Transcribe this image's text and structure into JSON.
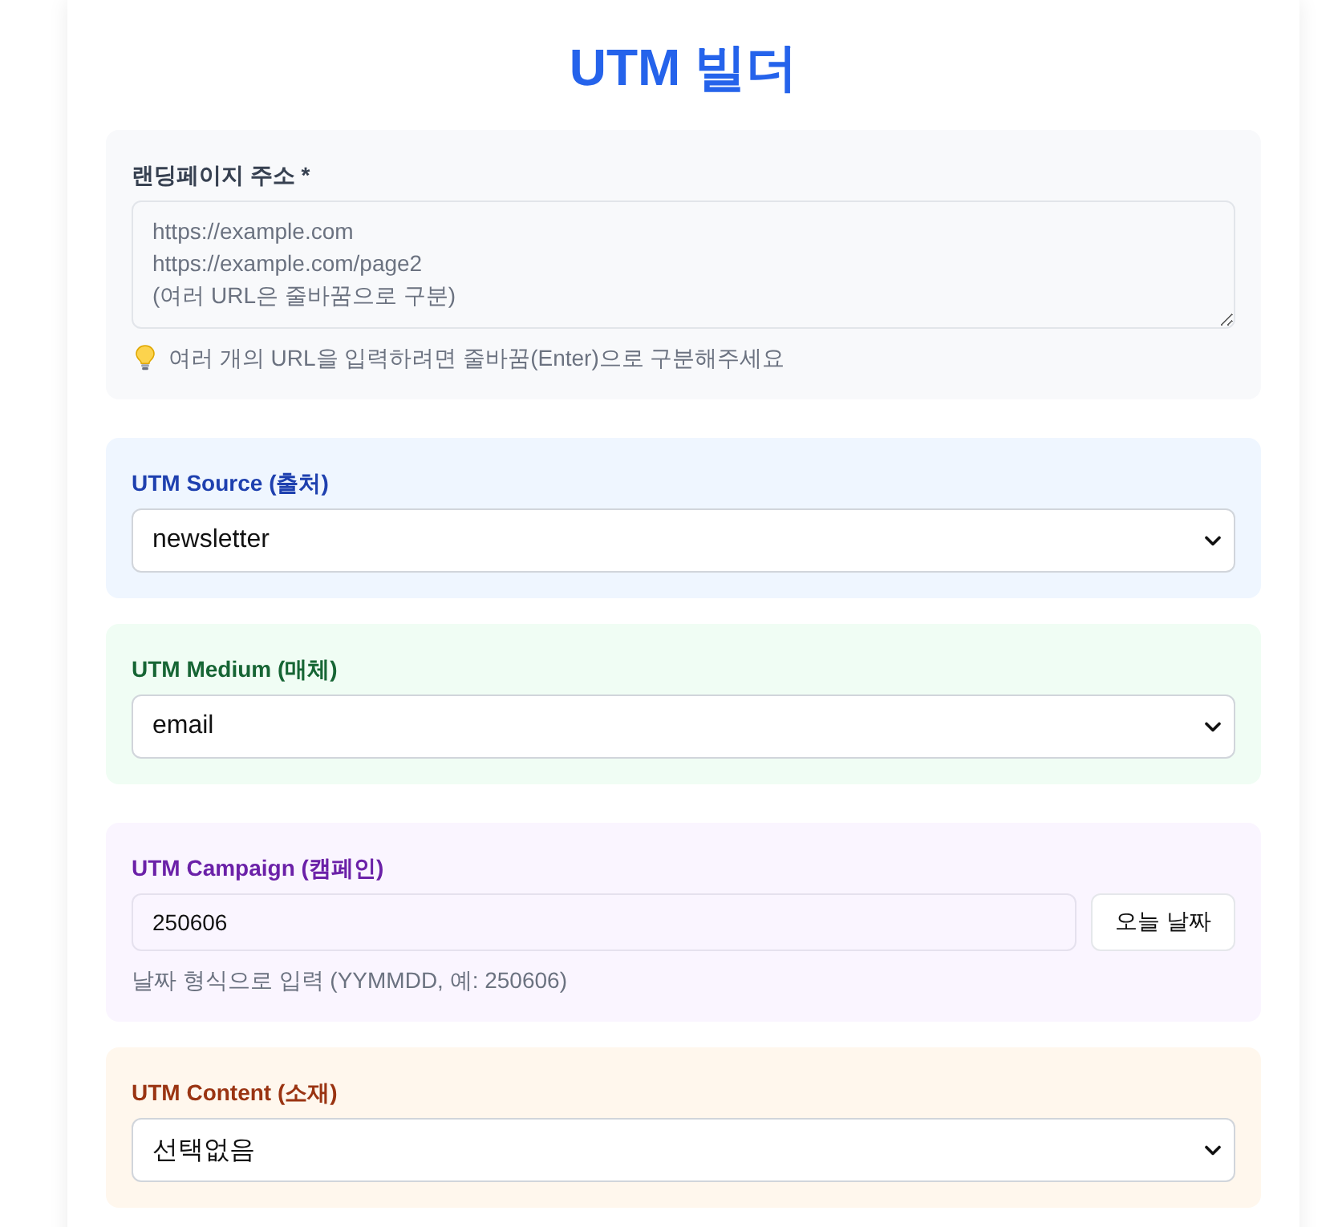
{
  "title": "UTM 빌더",
  "landing": {
    "label": "랜딩페이지 주소 *",
    "placeholder": "https://example.com\nhttps://example.com/page2\n(여러 URL은 줄바꿈으로 구분)",
    "hint": "여러 개의 URL을 입력하려면 줄바꿈(Enter)으로 구분해주세요"
  },
  "fields": [
    {
      "kind": "select",
      "label": "UTM Source (출처)",
      "color": "#1e40af",
      "value": "newsletter"
    },
    {
      "kind": "select",
      "label": "UTM Medium (매체)",
      "color": "#166534",
      "value": "email"
    },
    {
      "kind": "text_with_button",
      "label": "UTM Campaign (캠페인)",
      "color": "#6b21a8",
      "value": "250606",
      "button": "오늘 날짜",
      "hint": "날짜 형식으로 입력 (YYMMDD, 예: 250606)"
    },
    {
      "kind": "select",
      "label": "UTM Content (소재)",
      "color": "#9a3412",
      "value": "선택없음"
    }
  ]
}
